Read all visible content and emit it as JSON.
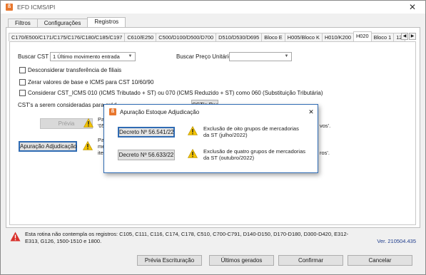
{
  "window": {
    "title": "EFD ICMS/IPI",
    "close_glyph": "✕"
  },
  "outer_tabs": [
    {
      "label": "Filtros"
    },
    {
      "label": "Configurações"
    },
    {
      "label": "Registros"
    }
  ],
  "inner_tabs": [
    {
      "label": "C170/E500/C171/C175/C176/C180/C185/C197"
    },
    {
      "label": "C610/E250"
    },
    {
      "label": "C500/D100/D500/D700"
    },
    {
      "label": "D510/D530/D695"
    },
    {
      "label": "Bloco E"
    },
    {
      "label": "H005/Bloco K"
    },
    {
      "label": "H010/K200"
    },
    {
      "label": "H020"
    },
    {
      "label": "Bloco 1"
    },
    {
      "label": "12"
    }
  ],
  "tab_scroll": {
    "left": "◀",
    "right": "▶"
  },
  "form": {
    "buscar_cst_label": "Buscar CST",
    "buscar_cst_value": "1 Último movimento entrada",
    "buscar_preco_label": "Buscar Preço Unitário",
    "buscar_preco_value": "",
    "dropdown_glyph": "▼",
    "cb_desconsiderar": "Desconsiderar transferência de filiais",
    "cb_zerar": "Zerar valores de base e ICMS para CST 10/60/90",
    "cb_considerar": "Considerar CST_ICMS 010 (ICMS Tributado + ST) ou 070 (ICMS Reduzido + ST) como 060 (Substituição Tributária)",
    "cst_creditos_label": "CST's a serem consideradas para créd",
    "cst_button_partial": "CST's Para D5",
    "previa_button": "Prévia",
    "previa_desc_1": "Par",
    "previa_desc_2": "'05",
    "previa_desc_right": "vos'.",
    "apuracao_button": "Apuração Adjudicação",
    "apuracao_desc_1": "Par",
    "apuracao_desc_2": "mer",
    "apuracao_desc_3": "iter",
    "apuracao_desc_right": "ros'."
  },
  "dialog": {
    "title": "Apuração Estoque Adjudicação",
    "close_glyph": "✕",
    "decreto1_button": "Decreto Nº 56.541/22",
    "decreto1_desc_1": "Exclusão de oito grupos de mercadorias",
    "decreto1_desc_2": "da ST  (julho/2022)",
    "decreto2_button": "Decreto Nº 56.633/22",
    "decreto2_desc_1": "Exclusão de quatro grupos de mercadorias",
    "decreto2_desc_2": "da ST  (outubro/2022)"
  },
  "footer": {
    "note": "Esta rotina não contempla os registros: C105, C111, C116, C174, C178, C510, C700-C791, D140-D150, D170-D180, D300-D420, E312-E313, G126, 1500-1510 e 1800.",
    "version": "Ver. 210504.435",
    "btn_previa_escrituracao": "Prévia Escrituração",
    "btn_ultimos_gerados": "Últimos gerados",
    "btn_confirmar": "Confirmar",
    "btn_cancelar": "Cancelar"
  },
  "colors": {
    "accent": "#2f6bb3",
    "warning": "#f2c200",
    "error": "#d8302a",
    "app_icon": "#e8772e"
  }
}
